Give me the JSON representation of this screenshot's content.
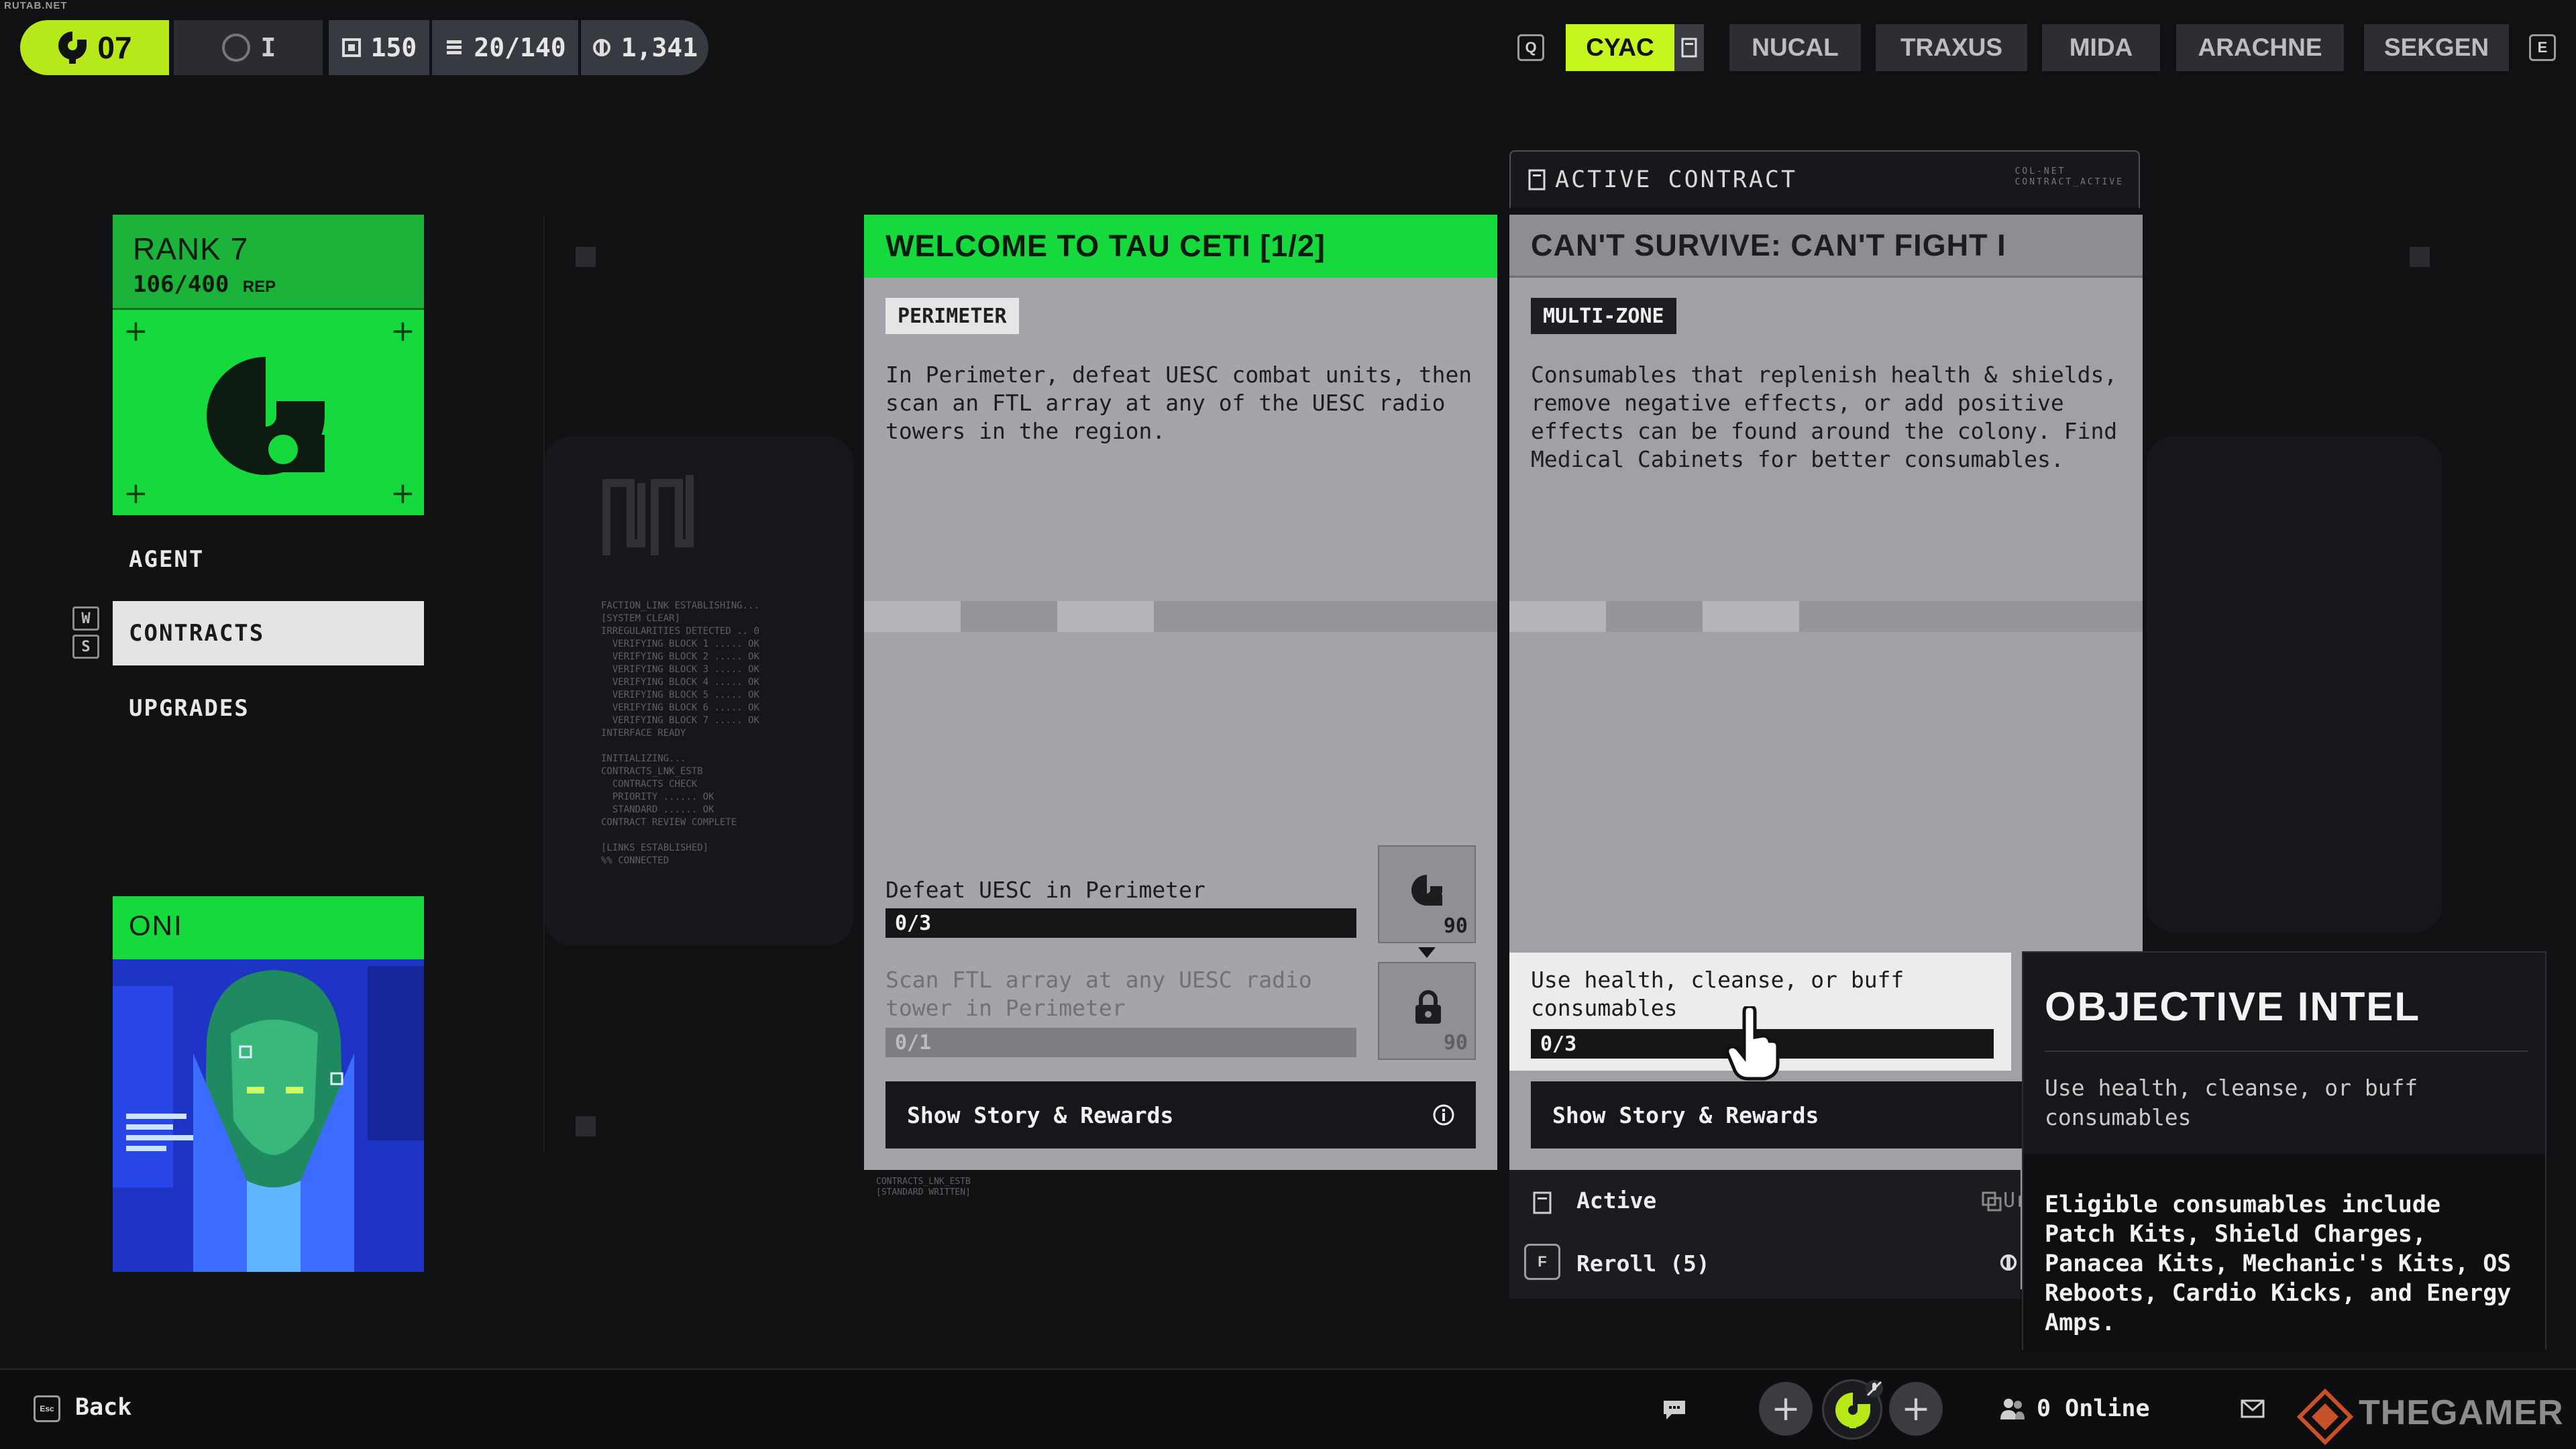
{
  "watermark_top": "RUTAB.NET",
  "topbar": {
    "level": "07",
    "prestige": "I",
    "stat_a": "150",
    "stat_b": "20/140",
    "stat_c": "1,341",
    "tab_key_left": "Q",
    "tab_key_right": "E",
    "factions": [
      {
        "label": "CYAC",
        "active": true
      },
      {
        "label": "NUCAL",
        "active": false
      },
      {
        "label": "TRAXUS",
        "active": false
      },
      {
        "label": "MIDA",
        "active": false
      },
      {
        "label": "ARACHNE",
        "active": false
      },
      {
        "label": "SEKGEN",
        "active": false
      }
    ]
  },
  "rank": {
    "title": "RANK 7",
    "rep": "106/400",
    "rep_unit": "REP"
  },
  "nav": {
    "key_up": "W",
    "key_down": "S",
    "items": [
      {
        "label": "AGENT",
        "active": false
      },
      {
        "label": "CONTRACTS",
        "active": true
      },
      {
        "label": "UPGRADES",
        "active": false
      }
    ]
  },
  "agent_card": {
    "name": "ONI"
  },
  "deco_log": "FACTION_LINK ESTABLISHING...\n[SYSTEM CLEAR]\nIRREGULARITIES DETECTED .. 0\n  VERIFYING BLOCK 1 ..... OK\n  VERIFYING BLOCK 2 ..... OK\n  VERIFYING BLOCK 3 ..... OK\n  VERIFYING BLOCK 4 ..... OK\n  VERIFYING BLOCK 5 ..... OK\n  VERIFYING BLOCK 6 ..... OK\n  VERIFYING BLOCK 7 ..... OK\nINTERFACE READY\n\nINITIALIZING...\nCONTRACTS_LNK_ESTB\n  CONTRACTS CHECK\n  PRIORITY ...... OK\n  STANDARD ...... OK\nCONTRACT REVIEW COMPLETE\n\n[LINKS ESTABLISHED]\n%% CONNECTED",
  "deco_small": "CONTRACTS_LNK_ESTB\n[STANDARD WRITTEN]",
  "contract1": {
    "title": "WELCOME TO TAU CETI [1/2]",
    "tag": "PERIMETER",
    "description": "In Perimeter, defeat UESC combat units, then scan an FTL array at any of the UESC radio towers in the region.",
    "objectives": [
      {
        "label": "Defeat UESC in Perimeter",
        "progress": "0/3",
        "reward": "90",
        "locked": false
      },
      {
        "label": "Scan FTL array at any UESC radio tower in Perimeter",
        "progress": "0/1",
        "reward": "90",
        "locked": true
      }
    ],
    "story_button": "Show Story & Rewards"
  },
  "active_contract": {
    "header": "ACTIVE CONTRACT",
    "mini_line1": "COL-NET",
    "mini_line2": "CONTRACT_ACTIVE",
    "title": "CAN'T SURVIVE: CAN'T FIGHT I",
    "tag": "MULTI-ZONE",
    "description": "Consumables that replenish health & shields, remove negative effects, or add positive effects can be found around the colony. Find Medical Cabinets for better consumables.",
    "objective": {
      "label": "Use health, cleanse, or buff consumables",
      "progress": "0/3"
    },
    "story_button": "Show Story & Rewards",
    "status": "Active",
    "status_right": "Ur",
    "reroll_key": "F",
    "reroll": "Reroll (5)"
  },
  "intel": {
    "title": "OBJECTIVE INTEL",
    "subtitle": "Use health, cleanse, or buff consumables",
    "body": "Eligible consumables include Patch Kits, Shield Charges, Panacea Kits, Mechanic's Kits, OS Reboots, Cardio Kicks, and Energy Amps."
  },
  "bottombar": {
    "back_key": "Esc",
    "back": "Back",
    "online": "0 Online",
    "brand": "THEGAMER"
  },
  "colors": {
    "accent_green": "#16d93d",
    "accent_lime": "#c5f51d",
    "agent_blue": "#1f3ccf"
  }
}
